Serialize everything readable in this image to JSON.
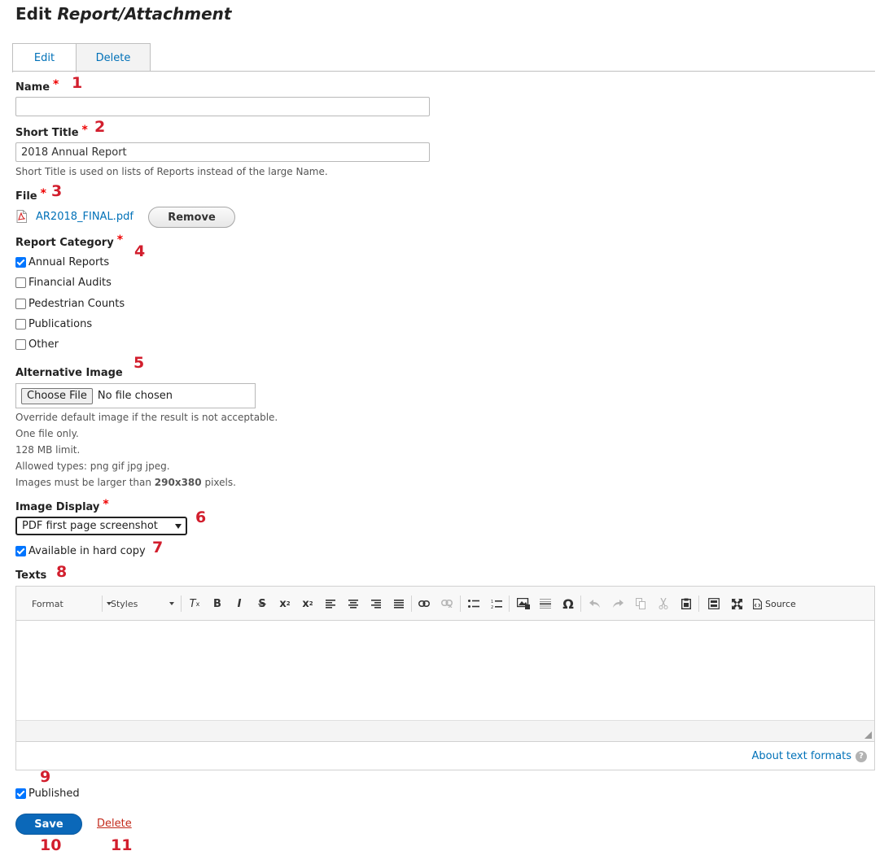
{
  "page": {
    "title_prefix": "Edit",
    "title_entity": "Report/Attachment"
  },
  "tabs": [
    {
      "label": "Edit",
      "active": true
    },
    {
      "label": "Delete",
      "active": false
    }
  ],
  "required_mark": "*",
  "fields": {
    "name": {
      "label": "Name",
      "value": "",
      "marker": "1"
    },
    "short_title": {
      "label": "Short Title",
      "value": "2018 Annual Report",
      "description": "Short Title is used on lists of Reports instead of the large Name.",
      "marker": "2"
    },
    "file": {
      "label": "File",
      "file_name": "AR2018_FINAL.pdf",
      "icon": "pdf-file-icon",
      "remove_label": "Remove",
      "marker": "3"
    },
    "report_category": {
      "label": "Report Category",
      "marker": "4",
      "options": [
        {
          "label": "Annual Reports",
          "checked": true
        },
        {
          "label": "Financial Audits",
          "checked": false
        },
        {
          "label": "Pedestrian Counts",
          "checked": false
        },
        {
          "label": "Publications",
          "checked": false
        },
        {
          "label": "Other",
          "checked": false
        }
      ]
    },
    "alternative_image": {
      "label": "Alternative Image",
      "marker": "5",
      "choose_label": "Choose File",
      "no_file": "No file chosen",
      "help": [
        "Override default image if the result is not acceptable.",
        "One file only.",
        "128 MB limit.",
        "Allowed types: png gif jpg jpeg."
      ],
      "size_prefix": "Images must be larger than",
      "size_value": "290x380",
      "size_suffix": "pixels."
    },
    "image_display": {
      "label": "Image Display",
      "marker": "6",
      "selected": "PDF first page screenshot"
    },
    "hard_copy": {
      "label": "Available in hard copy",
      "checked": true,
      "marker": "7"
    },
    "texts": {
      "label": "Texts",
      "marker": "8",
      "format_label": "Format",
      "styles_label": "Styles",
      "source_label": "Source",
      "about_label": "About text formats",
      "help_glyph": "?"
    },
    "published": {
      "label": "Published",
      "checked": true,
      "marker": "9"
    }
  },
  "actions": {
    "save_label": "Save",
    "save_marker": "10",
    "delete_label": "Delete",
    "delete_marker": "11"
  },
  "colors": {
    "link": "#0071b8",
    "required": "#e00000",
    "marker": "#d21e2d",
    "save_button": "#0b68b9",
    "delete_link": "#c32a1b"
  }
}
